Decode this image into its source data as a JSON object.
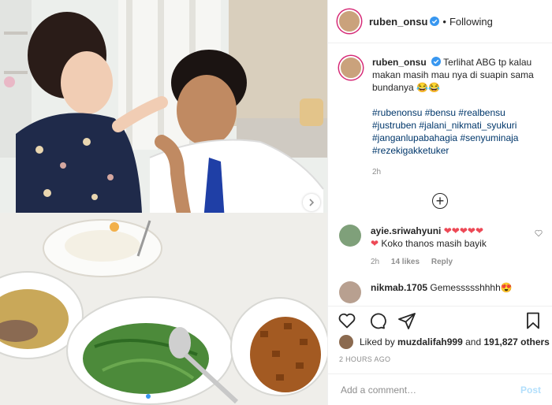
{
  "header": {
    "username": "ruben_onsu",
    "separator": "•",
    "follow_state": "Following"
  },
  "caption": {
    "username": "ruben_onsu",
    "text": "Terlihat ABG tp kalau makan masih mau nya di suapin sama bundanya 😂😂",
    "hashtags": "#rubenonsu #bensu #realbensu #justruben #jalani_nikmati_syukuri #janganlupabahagia #senyuminaja #rezekigakketuker",
    "time": "2h"
  },
  "comments": [
    {
      "username": "ayie.sriwahyuni",
      "text_line1_hearts": "❤❤❤❤❤",
      "text_line2_heart": "❤",
      "text_line2": "Koko thanos masih bayik",
      "time": "2h",
      "likes": "14 likes",
      "reply": "Reply"
    },
    {
      "username": "nikmab.1705",
      "text": "Gemessssshhhh😍"
    }
  ],
  "likes": {
    "prefix": "Liked by",
    "user": "muzdalifah999",
    "and": "and",
    "others": "191,827 others"
  },
  "posted_ago": "2 HOURS AGO",
  "add_comment": {
    "placeholder": "Add a comment…",
    "post_label": "Post"
  },
  "icons": {
    "next": "chevron-right-icon",
    "verified": "verified-badge-icon",
    "more_comments": "plus-circle-icon",
    "like": "heart-icon",
    "comment": "comment-icon",
    "share": "share-icon",
    "save": "bookmark-icon"
  },
  "carousel": {
    "total_dots": 5,
    "active_index": 0
  },
  "colors": {
    "accent": "#3897f0",
    "hashtag": "#00376b",
    "heart": "#ed4956",
    "muted": "#8e8e8e"
  }
}
